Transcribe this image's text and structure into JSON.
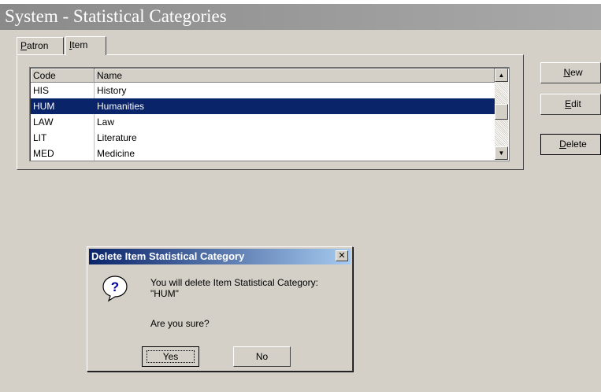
{
  "window": {
    "title": "System - Statistical Categories"
  },
  "tabs": [
    {
      "label": "Patron",
      "mnemonic": "P",
      "rest": "atron",
      "active": false
    },
    {
      "label": "Item",
      "mnemonic": "I",
      "rest": "tem",
      "active": true
    }
  ],
  "grid": {
    "columns": [
      "Code",
      "Name"
    ],
    "rows": [
      {
        "code": "HIS",
        "name": "History",
        "selected": false
      },
      {
        "code": "HUM",
        "name": "Humanities",
        "selected": true
      },
      {
        "code": "LAW",
        "name": "Law",
        "selected": false
      },
      {
        "code": "LIT",
        "name": "Literature",
        "selected": false
      },
      {
        "code": "MED",
        "name": "Medicine",
        "selected": false
      }
    ]
  },
  "buttons": {
    "new": {
      "mnemonic": "N",
      "rest": "ew"
    },
    "edit": {
      "mnemonic": "E",
      "rest": "dit"
    },
    "delete": {
      "mnemonic": "D",
      "rest": "elete"
    }
  },
  "dialog": {
    "title": "Delete Item Statistical Category",
    "close_glyph": "✕",
    "message_line1": "You will delete Item Statistical Category:",
    "message_line2": "\"HUM\"",
    "question": "Are you sure?",
    "yes_label": "Yes",
    "no_label": "No",
    "icon": "question-icon"
  },
  "colors": {
    "selection": "#0a246a",
    "dialog_title_start": "#0a246a",
    "dialog_title_end": "#a6caf0",
    "window_face": "#d4d0c8"
  }
}
